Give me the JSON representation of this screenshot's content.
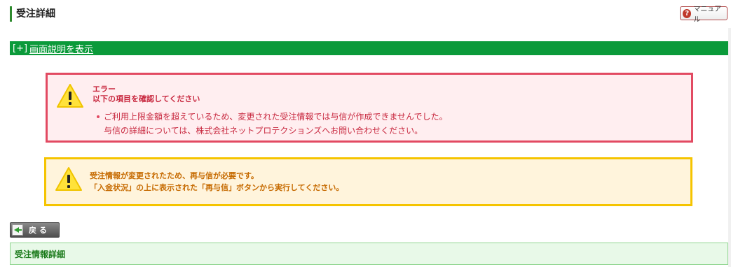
{
  "page": {
    "title": "受注詳細",
    "manual_label": "マニュアル"
  },
  "explain_bar": {
    "toggle": "[+]",
    "link": "画面説明を表示"
  },
  "error": {
    "title": "エラー",
    "subtitle": "以下の項目を確認してください",
    "items": [
      "ご利用上限金額を超えているため、変更された受注情報では与信が作成できませんでした。",
      "与信の詳細については、株式会社ネットプロテクションズへお問い合わせください。"
    ],
    "icon": "warning-triangle-icon",
    "border_color": "#e24a62"
  },
  "warning": {
    "lines": [
      "受注情報が変更されたため、再与信が必要です。",
      "「入金状況」の上に表示された「再与信」ボタンから実行してください。"
    ],
    "icon": "warning-triangle-icon",
    "border_color": "#f5c400"
  },
  "back_button": {
    "label": "戻 る"
  },
  "section": {
    "title": "受注情報詳細"
  },
  "colors": {
    "accent_green": "#0b9a3a",
    "error_text": "#c8283f",
    "warning_text": "#c66a00"
  }
}
